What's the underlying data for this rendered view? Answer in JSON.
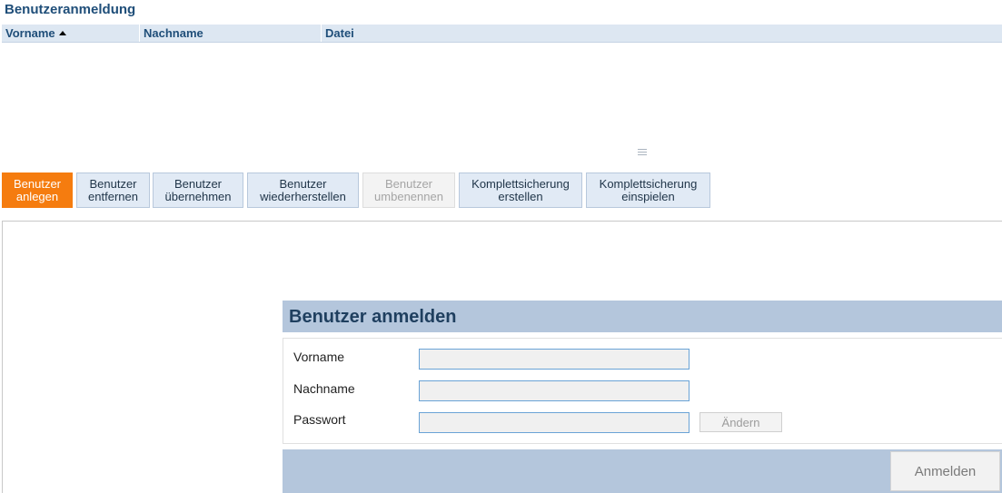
{
  "page": {
    "title": "Benutzeranmeldung"
  },
  "grid": {
    "columns": [
      {
        "label": "Vorname",
        "sorted": "ascending"
      },
      {
        "label": "Nachname"
      },
      {
        "label": "Datei"
      }
    ],
    "rows": []
  },
  "toolbar": {
    "buttons": [
      {
        "line1": "Benutzer",
        "line2": "anlegen",
        "state": "active"
      },
      {
        "line1": "Benutzer",
        "line2": "entfernen",
        "state": "enabled"
      },
      {
        "line1": "Benutzer",
        "line2": "übernehmen",
        "state": "enabled"
      },
      {
        "line1": "Benutzer",
        "line2": "wiederherstellen",
        "state": "enabled"
      },
      {
        "line1": "Benutzer",
        "line2": "umbenennen",
        "state": "disabled"
      },
      {
        "line1": "Komplettsicherung",
        "line2": "erstellen",
        "state": "enabled"
      },
      {
        "line1": "Komplettsicherung",
        "line2": "einspielen",
        "state": "enabled"
      }
    ]
  },
  "dialog": {
    "title": "Benutzer anmelden",
    "fields": [
      {
        "label": "Vorname",
        "value": ""
      },
      {
        "label": "Nachname",
        "value": ""
      },
      {
        "label": "Passwort",
        "value": ""
      }
    ],
    "change_label": "Ändern",
    "submit_label": "Anmelden"
  },
  "colors": {
    "accent": "#f57c0f",
    "header_text": "#1f4e79",
    "dialog_bar": "#b4c6dc",
    "toolbar_button": "#e1eaf5"
  }
}
